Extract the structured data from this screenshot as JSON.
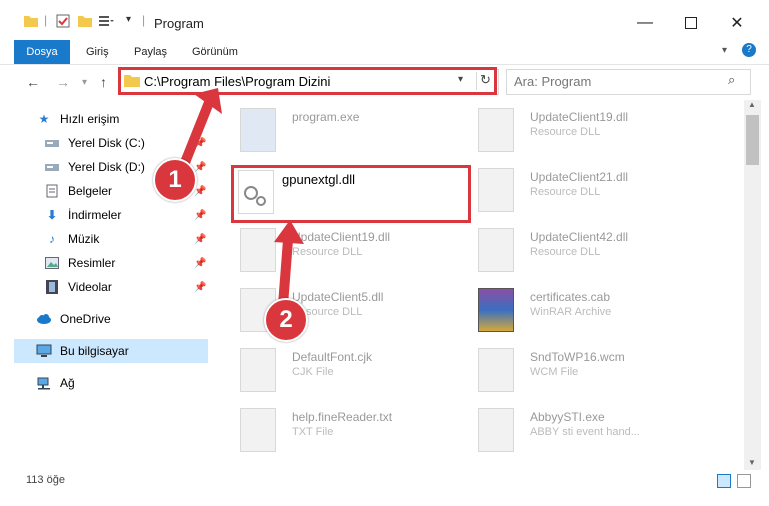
{
  "window": {
    "title": "Program"
  },
  "ribbon": {
    "tabs": [
      "Dosya",
      "Giriş",
      "Paylaş",
      "Görünüm"
    ]
  },
  "address": {
    "path": "C:\\Program Files\\Program Dizini"
  },
  "search": {
    "placeholder": "Ara: Program"
  },
  "sidebar": {
    "items": [
      {
        "label": "Hızlı erişim",
        "icon": "star-icon"
      },
      {
        "label": "Yerel Disk (C:)",
        "icon": "drive-icon"
      },
      {
        "label": "Yerel Disk (D:)",
        "icon": "drive-icon"
      },
      {
        "label": "Belgeler",
        "icon": "documents-icon"
      },
      {
        "label": "İndirmeler",
        "icon": "download-icon"
      },
      {
        "label": "Müzik",
        "icon": "music-icon"
      },
      {
        "label": "Resimler",
        "icon": "pictures-icon"
      },
      {
        "label": "Videolar",
        "icon": "videos-icon"
      },
      {
        "label": "OneDrive",
        "icon": "cloud-icon"
      },
      {
        "label": "Bu bilgisayar",
        "icon": "computer-icon"
      },
      {
        "label": "Ağ",
        "icon": "network-icon"
      }
    ]
  },
  "files": [
    {
      "name": "program.exe",
      "type": ""
    },
    {
      "name": "UpdateClient19.dll",
      "type": "Resource DLL"
    },
    {
      "name": "gpunextgl.dll",
      "type": ""
    },
    {
      "name": "UpdateClient21.dll",
      "type": "Resource DLL"
    },
    {
      "name": "UpdateClient19.dll",
      "type": "Resource DLL"
    },
    {
      "name": "UpdateClient42.dll",
      "type": "Resource DLL"
    },
    {
      "name": "UpdateClient5.dll",
      "type": "Resource DLL"
    },
    {
      "name": "certificates.cab",
      "type": "WinRAR Archive"
    },
    {
      "name": "DefaultFont.cjk",
      "type": "CJK File"
    },
    {
      "name": "SndToWP16.wcm",
      "type": "WCM File"
    },
    {
      "name": "help.fineReader.txt",
      "type": "TXT File"
    },
    {
      "name": "AbbyySTI.exe",
      "type": "ABBY sti event hand..."
    }
  ],
  "status": {
    "count": "113 öğe"
  },
  "badges": [
    "1",
    "2"
  ],
  "colors": {
    "accent": "#1979ca",
    "highlight": "#d9373d",
    "selection": "#cce8ff"
  }
}
